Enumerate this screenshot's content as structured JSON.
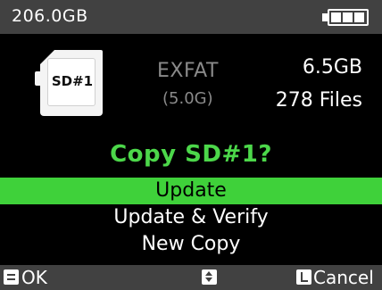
{
  "status": {
    "capacity": "206.0GB",
    "battery_icon": "battery-full-icon"
  },
  "card": {
    "icon": "sd-card-icon",
    "label": "SD#1",
    "filesystem": "EXFAT",
    "filesystem_size": "(5.0G)",
    "size": "6.5GB",
    "files": "278 Files"
  },
  "prompt": "Copy SD#1?",
  "menu": {
    "items": [
      {
        "label": "Update",
        "selected": true
      },
      {
        "label": "Update & Verify",
        "selected": false
      },
      {
        "label": "New Copy",
        "selected": false
      }
    ]
  },
  "softkeys": {
    "ok_label": "OK",
    "ok_icon": "menu-key-icon",
    "nav_icon": "up-down-key-icon",
    "cancel_label": "Cancel",
    "cancel_icon": "l-key-icon"
  },
  "colors": {
    "accent_green": "#3fd13a",
    "bar_gray": "#414141",
    "muted_text": "#8a8a8a"
  }
}
